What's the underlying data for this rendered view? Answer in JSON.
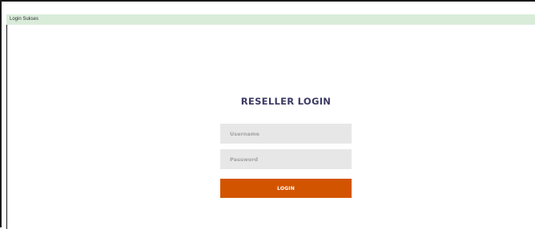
{
  "status_bar": {
    "message": "Login Sukses",
    "background_color": "#d9ecda"
  },
  "login_form": {
    "title": "RESELLER LOGIN",
    "username": {
      "placeholder": "Username",
      "value": ""
    },
    "password": {
      "placeholder": "Password",
      "value": ""
    },
    "submit_label": "LOGIN",
    "accent_color": "#d35400",
    "title_color": "#3b3a63"
  }
}
